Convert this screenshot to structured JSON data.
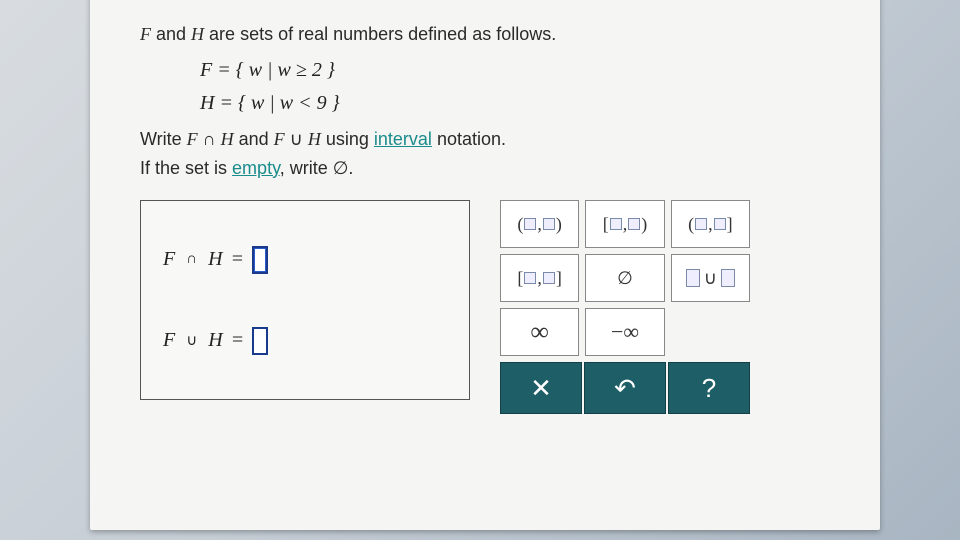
{
  "problem": {
    "intro_prefix": "F",
    "intro_mid": " and ",
    "intro_H": "H",
    "intro_suffix": " are sets of real numbers defined as follows.",
    "set_F": "F = { w | w ≥ 2 }",
    "set_H": "H = { w | w < 9 }",
    "instruction_write": "Write ",
    "inst_F1": "F",
    "inst_int": " ∩ ",
    "inst_H1": "H",
    "inst_and": " and ",
    "inst_F2": "F",
    "inst_un": " ∪ ",
    "inst_H2": "H",
    "inst_using": " using ",
    "link_interval": "interval",
    "inst_notation": " notation.",
    "empty_prefix": "If the set is ",
    "link_empty": "empty",
    "empty_suffix": ", write ∅."
  },
  "answers": {
    "row1_F": "F",
    "row1_op": "∩",
    "row1_H": "H",
    "row1_eq": "=",
    "row2_F": "F",
    "row2_op": "∪",
    "row2_H": "H",
    "row2_eq": "="
  },
  "palette": {
    "open_open": "( , )",
    "closed_open": "[ , )",
    "open_closed": "( , ]",
    "closed_closed": "[ , ]",
    "empty_set": "∅",
    "union": "∪",
    "infinity": "∞",
    "neg_infinity": "−∞"
  },
  "actions": {
    "clear": "✕",
    "undo": "↶",
    "help": "?"
  }
}
